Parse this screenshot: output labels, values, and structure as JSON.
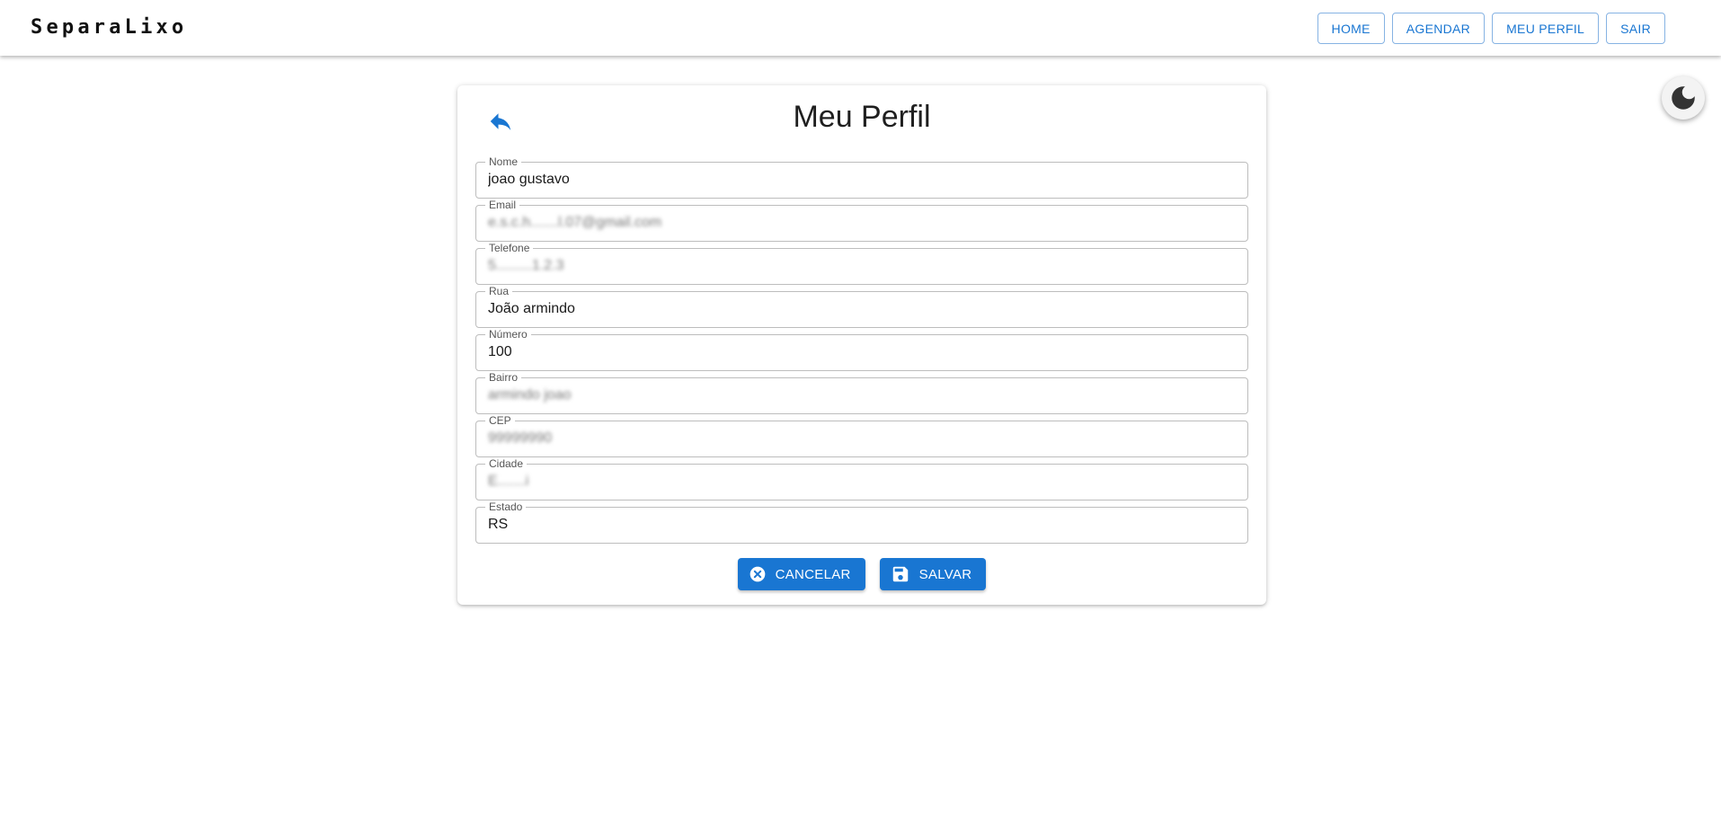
{
  "brand": {
    "name": "SeparaLixo"
  },
  "nav": {
    "home": "HOME",
    "agendar": "AGENDAR",
    "meu_perfil": "MEU PERFIL",
    "sair": "SAIR"
  },
  "theme": {
    "icon": "moon-icon"
  },
  "profile": {
    "title": "Meu Perfil",
    "back_icon": "reply-arrow-icon",
    "fields": {
      "nome": {
        "label": "Nome",
        "value": "joao gustavo"
      },
      "email": {
        "label": "Email",
        "value": "e.s.c.h.......l.07@gmail.com"
      },
      "telefone": {
        "label": "Telefone",
        "value": "5.........1.2.3"
      },
      "rua": {
        "label": "Rua",
        "value": "João armindo"
      },
      "numero": {
        "label": "Número",
        "value": "100"
      },
      "bairro": {
        "label": "Bairro",
        "value": "armindo joao"
      },
      "cep": {
        "label": "CEP",
        "value": "99999990"
      },
      "cidade": {
        "label": "Cidade",
        "value": "E.......i"
      },
      "estado": {
        "label": "Estado",
        "value": "RS"
      }
    },
    "actions": {
      "cancel_label": "CANCELAR",
      "cancel_icon": "cancel-circle-icon",
      "save_label": "SALVAR",
      "save_icon": "floppy-disk-icon"
    }
  },
  "colors": {
    "primary": "#1976d2",
    "nav_border": "#86b3e3",
    "field_border": "#bdbdbd"
  }
}
